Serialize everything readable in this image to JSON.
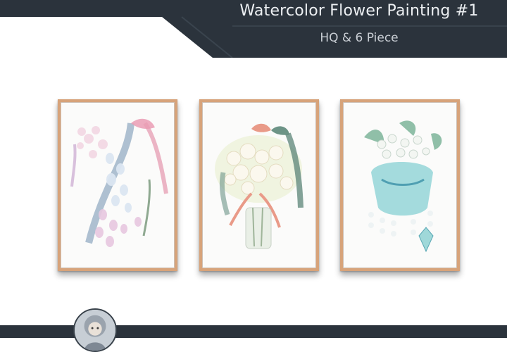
{
  "header": {
    "title": "Watercolor Flower Painting #1",
    "subtitle": "HQ & 6 Piece"
  },
  "paintings": [
    {
      "subject": "lily-of-the-valley cascade with pink and blue ribbon"
    },
    {
      "subject": "white flower bouquet in glass vase with pink ribbon bow"
    },
    {
      "subject": "white flowers in teal hanging planter with crystal drops"
    }
  ],
  "colors": {
    "header_band": "#2b333c",
    "frame": "#d7a37a",
    "background": "#ffffff"
  }
}
